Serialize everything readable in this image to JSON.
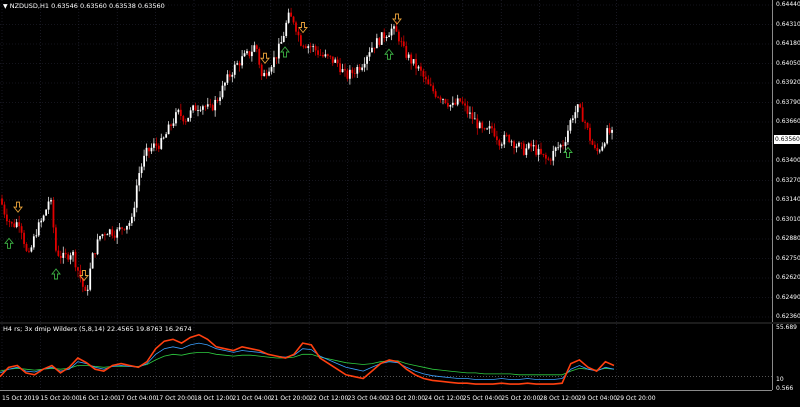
{
  "window": {
    "title": "NZDUSD,H1  0.63546 0.63560 0.63538 0.63560",
    "menu_icon": "triangle-down-icon"
  },
  "price_axis": [
    "0.64440",
    "0.64310",
    "0.64180",
    "0.64050",
    "0.63920",
    "0.63790",
    "0.63660",
    "0.63530",
    "0.63400",
    "0.63270",
    "0.63140",
    "0.63010",
    "0.62880",
    "0.62750",
    "0.62620",
    "0.62490",
    "0.62360"
  ],
  "current_price": "0.63560",
  "indicator": {
    "title": "H4 rs; 3x dmip Wilders (5,8,14) 22.4565 19.8763 16.2674",
    "axis_labels": [
      "55.689",
      "10",
      "0.566"
    ]
  },
  "time_axis": [
    "15 Oct 2019",
    "15 Oct 20:00",
    "16 Oct 12:00",
    "17 Oct 04:00",
    "17 Oct 20:00",
    "18 Oct 12:00",
    "21 Oct 04:00",
    "21 Oct 20:00",
    "22 Oct 12:00",
    "23 Oct 04:00",
    "23 Oct 20:00",
    "24 Oct 12:00",
    "25 Oct 04:00",
    "25 Oct 20:00",
    "28 Oct 12:00",
    "29 Oct 04:00",
    "29 Oct 20:00"
  ],
  "colors": {
    "bull": "#ffffff",
    "bear": "#e00000",
    "grid": "#2a2a3a",
    "up_arrow": "#3cb043",
    "down_arrow": "#e8a13a",
    "ind_fast": "#ff4010",
    "ind_mid": "#3aa0ff",
    "ind_slow": "#2ecc40"
  },
  "chart_data": {
    "type": "candlestick",
    "symbol": "NZDUSD",
    "timeframe": "H1",
    "ylim": [
      0.6236,
      0.6444
    ],
    "path": [
      [
        0,
        0.6315
      ],
      [
        5,
        0.6305
      ],
      [
        12,
        0.6297
      ],
      [
        20,
        0.63
      ],
      [
        28,
        0.6274
      ],
      [
        36,
        0.6293
      ],
      [
        44,
        0.6303
      ],
      [
        50,
        0.6317
      ],
      [
        56,
        0.628
      ],
      [
        64,
        0.6275
      ],
      [
        72,
        0.628
      ],
      [
        80,
        0.6263
      ],
      [
        86,
        0.6249
      ],
      [
        92,
        0.6275
      ],
      [
        100,
        0.629
      ],
      [
        108,
        0.6294
      ],
      [
        116,
        0.6292
      ],
      [
        124,
        0.6297
      ],
      [
        132,
        0.63
      ],
      [
        138,
        0.633
      ],
      [
        146,
        0.6345
      ],
      [
        154,
        0.635
      ],
      [
        162,
        0.6352
      ],
      [
        170,
        0.6363
      ],
      [
        178,
        0.6372
      ],
      [
        186,
        0.6368
      ],
      [
        194,
        0.6375
      ],
      [
        202,
        0.6378
      ],
      [
        210,
        0.6374
      ],
      [
        218,
        0.6382
      ],
      [
        226,
        0.6393
      ],
      [
        234,
        0.6402
      ],
      [
        242,
        0.6408
      ],
      [
        250,
        0.6412
      ],
      [
        256,
        0.6418
      ],
      [
        262,
        0.6395
      ],
      [
        268,
        0.6402
      ],
      [
        276,
        0.641
      ],
      [
        282,
        0.642
      ],
      [
        288,
        0.6436
      ],
      [
        294,
        0.6434
      ],
      [
        300,
        0.642
      ],
      [
        306,
        0.6418
      ],
      [
        314,
        0.6415
      ],
      [
        322,
        0.641
      ],
      [
        330,
        0.6408
      ],
      [
        338,
        0.6405
      ],
      [
        346,
        0.6396
      ],
      [
        354,
        0.64
      ],
      [
        362,
        0.6405
      ],
      [
        370,
        0.6415
      ],
      [
        378,
        0.642
      ],
      [
        386,
        0.6425
      ],
      [
        392,
        0.6428
      ],
      [
        398,
        0.6424
      ],
      [
        404,
        0.6413
      ],
      [
        412,
        0.6406
      ],
      [
        420,
        0.64
      ],
      [
        428,
        0.639
      ],
      [
        436,
        0.6385
      ],
      [
        444,
        0.6382
      ],
      [
        452,
        0.6376
      ],
      [
        460,
        0.638
      ],
      [
        468,
        0.6372
      ],
      [
        476,
        0.6366
      ],
      [
        484,
        0.6358
      ],
      [
        492,
        0.6362
      ],
      [
        500,
        0.6353
      ],
      [
        508,
        0.6356
      ],
      [
        516,
        0.6351
      ],
      [
        524,
        0.6347
      ],
      [
        532,
        0.635
      ],
      [
        540,
        0.6344
      ],
      [
        548,
        0.634
      ],
      [
        556,
        0.6348
      ],
      [
        564,
        0.6352
      ],
      [
        572,
        0.637
      ],
      [
        578,
        0.6375
      ],
      [
        584,
        0.6368
      ],
      [
        590,
        0.6355
      ],
      [
        596,
        0.6345
      ],
      [
        602,
        0.6351
      ],
      [
        608,
        0.636
      ],
      [
        614,
        0.6356
      ]
    ],
    "up_arrows_x": [
      9,
      56,
      285,
      389,
      568
    ],
    "down_arrows_x": [
      18,
      84,
      265,
      303,
      397
    ],
    "indicator_series": [
      {
        "values": [
          10,
          20,
          22,
          14,
          12,
          18,
          22,
          14,
          20,
          30,
          25,
          18,
          16,
          22,
          24,
          22,
          20,
          26,
          40,
          48,
          50,
          46,
          52,
          55,
          50,
          42,
          40,
          38,
          42,
          40,
          38,
          34,
          32,
          30,
          34,
          46,
          44,
          30,
          24,
          18,
          12,
          10,
          8,
          16,
          24,
          28,
          26,
          18,
          12,
          8,
          6,
          5,
          4,
          3,
          3,
          2,
          2,
          2,
          3,
          2,
          2,
          3,
          2,
          2,
          2,
          3,
          24,
          28,
          20,
          16,
          26,
          22
        ]
      },
      {
        "values": [
          14,
          18,
          20,
          16,
          15,
          18,
          20,
          16,
          18,
          26,
          24,
          20,
          18,
          21,
          22,
          21,
          20,
          24,
          34,
          40,
          42,
          40,
          44,
          46,
          44,
          40,
          38,
          36,
          38,
          37,
          36,
          34,
          32,
          31,
          33,
          40,
          39,
          32,
          28,
          24,
          20,
          18,
          16,
          20,
          24,
          26,
          25,
          20,
          16,
          13,
          11,
          10,
          9,
          8,
          8,
          7,
          7,
          7,
          8,
          7,
          7,
          8,
          7,
          7,
          7,
          8,
          18,
          22,
          18,
          16,
          20,
          18
        ]
      },
      {
        "values": [
          16,
          18,
          19,
          18,
          17,
          18,
          19,
          18,
          19,
          22,
          22,
          21,
          20,
          21,
          21,
          21,
          21,
          23,
          28,
          32,
          34,
          33,
          35,
          36,
          36,
          34,
          33,
          32,
          33,
          33,
          32,
          31,
          30,
          30,
          31,
          34,
          34,
          31,
          29,
          27,
          25,
          24,
          23,
          24,
          26,
          27,
          27,
          24,
          22,
          20,
          18,
          17,
          16,
          15,
          14,
          14,
          13,
          13,
          13,
          13,
          12,
          12,
          12,
          12,
          12,
          12,
          16,
          19,
          18,
          17,
          19,
          18
        ]
      }
    ]
  }
}
